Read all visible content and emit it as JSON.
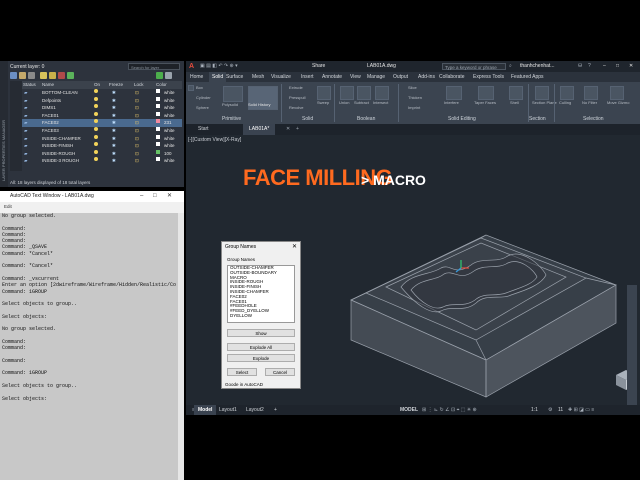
{
  "layer_manager": {
    "panel_label": "LAYER PROPERTIES MANAGER",
    "current_layer": "Current layer: 0",
    "search_placeholder": "Search for layer",
    "columns": [
      "Status",
      "Name",
      "On",
      "Freeze",
      "Lock",
      "Color"
    ],
    "rows": [
      {
        "name": "BOTTOM-CLEAN",
        "color": "white",
        "swatch": "#ffffff",
        "selected": false
      },
      {
        "name": "Defpoints",
        "color": "white",
        "swatch": "#ffffff",
        "selected": false
      },
      {
        "name": "DIMS1",
        "color": "white",
        "swatch": "#ffffff",
        "selected": false
      },
      {
        "name": "FACE01",
        "color": "white",
        "swatch": "#ffffff",
        "selected": false
      },
      {
        "name": "FACE02",
        "color": "231",
        "swatch": "#f08aa0",
        "selected": true
      },
      {
        "name": "FACE03",
        "color": "white",
        "swatch": "#ffffff",
        "selected": false
      },
      {
        "name": "INSIDE-CHAMFER",
        "color": "white",
        "swatch": "#ffffff",
        "selected": false
      },
      {
        "name": "INSIDE-FINISH",
        "color": "white",
        "swatch": "#ffffff",
        "selected": false
      },
      {
        "name": "INSIDE-ROUGH",
        "color": "100",
        "swatch": "#66c266",
        "selected": false
      },
      {
        "name": "INSIDE-3 ROUGH",
        "color": "white",
        "swatch": "#ffffff",
        "selected": false
      }
    ],
    "status_text": "All: 18 layers displayed of 18 total layers"
  },
  "text_window": {
    "title": "AutoCAD Text Window - LAB01A.dwg",
    "menu": "Edit",
    "lines": [
      "No group selected.",
      "",
      "Command:",
      "Command:",
      "Command:",
      "Command: _QSAVE",
      "Command: *Cancel*",
      "",
      "Command: *Cancel*",
      "",
      "Command: _vscurrent",
      "Enter an option [2dwireframe/Wireframe/Hidden/Realistic/Co",
      "Command: 1GROUP",
      "",
      "Select objects to group..",
      "",
      "Select objects:",
      "",
      "No group selected.",
      "",
      "Command:",
      "Command:",
      "",
      "Command:",
      "",
      "Command: 1GROUP",
      "",
      "Select objects to group..",
      "",
      "Select objects:"
    ]
  },
  "titlebar": {
    "share": "Share",
    "filename": "LAB01A.dwg",
    "search_placeholder": "Type a keyword or phrase",
    "user": "thanhchenhat...",
    "tabs": [
      "Home",
      "Solid",
      "Surface",
      "Mesh",
      "Visualize",
      "Insert",
      "Annotate",
      "View",
      "Manage",
      "Output",
      "Add-ins",
      "Collaborate",
      "Express Tools",
      "Featured Apps"
    ],
    "active_tab": "Solid"
  },
  "ribbon": {
    "items": [
      "Box",
      "Cylinder",
      "Sphere",
      "Polysolid",
      "Solid History",
      "Extrude",
      "Presspull",
      "Revolve",
      "Sweep",
      "Union",
      "Subtract",
      "Intersect",
      "Slice",
      "Thicken",
      "Imprint",
      "Interfere",
      "Taper Faces",
      "Shell",
      "Section Plane",
      "Culling",
      "No Filter",
      "Move Gizmo"
    ],
    "groups": [
      "Primitive",
      "Solid",
      "Boolean",
      "Solid Editing",
      "Section",
      "Selection"
    ]
  },
  "doc_tabs": {
    "start": "Start",
    "active": "LAB01A*"
  },
  "viewport": {
    "label": "[-][Custom View][X-Ray]",
    "overlay_title": "FACE MILLING",
    "overlay_sub": "> MACRO"
  },
  "group_dialog": {
    "title": "Group Names",
    "list_label": "Group Names",
    "items": [
      "OUTSIDE-CHAMFER",
      "OUTSIDE-BOUNDARY",
      "MACRO",
      "INSIDE-ROUGH",
      "INSIDE-FINISH",
      "INSIDE-CHAMFER",
      "FACE02",
      "FACE01",
      "#FEEDHOLE",
      "#FEED_DYELLOW",
      "DYELLOW"
    ],
    "show": "Show",
    "explode_all": "Explode All",
    "explode": "Explode",
    "select": "Select",
    "cancel": "Cancel",
    "footer": "Goode in AutoCAD"
  },
  "layout_tabs": {
    "model": "Model",
    "layout1": "Layout1",
    "layout2": "Layout2",
    "add": "+",
    "status_model": "MODEL",
    "scale": "1:1",
    "count": "11"
  }
}
